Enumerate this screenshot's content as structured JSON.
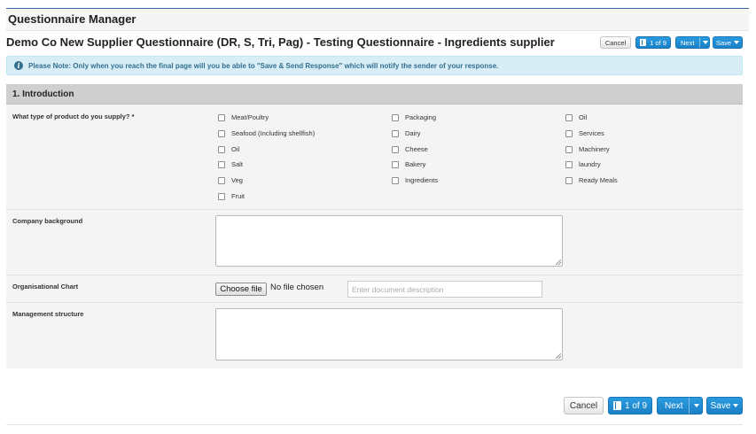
{
  "app": {
    "title": "Questionnaire Manager"
  },
  "page": {
    "title": "Demo Co New Supplier Questionnaire (DR, S, Tri, Pag) - Testing Questionnaire - Ingredients supplier"
  },
  "toolbar": {
    "cancel": "Cancel",
    "page_indicator": "1 of 9",
    "next": "Next",
    "save": "Save"
  },
  "notice": {
    "text": "Please Note: Only when you reach the final page will you be able to \"Save & Send Response\" which will notify the sender of your response."
  },
  "section": {
    "title": "1. Introduction"
  },
  "questions": {
    "product_type": {
      "label": "What type of product do you supply? *",
      "options": [
        "Meat/Poultry",
        "Packaging",
        "Oil",
        "Seafood (Including shellfish)",
        "Dairy",
        "Services",
        "Oil",
        "Cheese",
        "Machinery",
        "Salt",
        "Bakery",
        "laundry",
        "Veg",
        "Ingredients",
        "Ready Meals",
        "Fruit"
      ]
    },
    "company_background": {
      "label": "Company background",
      "value": ""
    },
    "org_chart": {
      "label": "Organisational Chart",
      "choose_file": "Choose file",
      "file_status": "No file chosen",
      "description_placeholder": "Enter document description",
      "description_value": ""
    },
    "management_structure": {
      "label": "Management structure",
      "value": ""
    }
  },
  "footer": {
    "cancel": "Cancel",
    "page_indicator": "1 of 9",
    "next": "Next",
    "save": "Save"
  },
  "colors": {
    "primary": "#1b80c6",
    "info_bg": "#d9edf7",
    "info_text": "#31708f",
    "section_bg": "#cfcfcf"
  }
}
